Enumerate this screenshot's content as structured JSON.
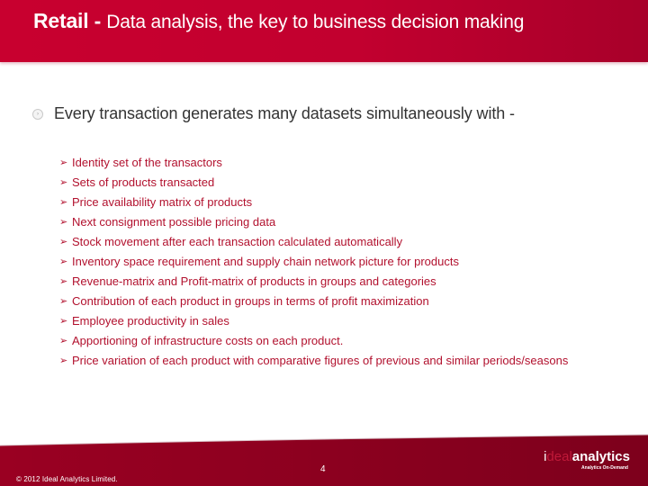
{
  "header": {
    "title_strong": "Retail - ",
    "title_rest": "Data analysis, the key to business decision making"
  },
  "main_point": "Every transaction generates many datasets simultaneously with  -",
  "sub_points": [
    "Identity set of the transactors",
    "Sets of products transacted",
    "Price availability matrix of products",
    "Next consignment possible pricing data",
    "Stock movement after each transaction calculated automatically",
    "Inventory space requirement and supply chain network picture for products",
    "Revenue-matrix and Profit-matrix of  products in groups and categories",
    "Contribution of each product in groups in terms of profit maximization",
    "Employee productivity in sales",
    "Apportioning of infrastructure costs on each product.",
    "Price variation of each product with comparative figures of previous and similar periods/seasons"
  ],
  "icons": {
    "main_bullet": "circle-chevron-icon",
    "sub_bullet": "arrowhead-icon",
    "sub_bullet_glyph": "➢"
  },
  "footer": {
    "copyright": "© 2012 Ideal Analytics Limited.",
    "page_number": "4",
    "logo_i": "i",
    "logo_deal": "deal",
    "logo_analytics": "analytics",
    "logo_tagline": "Analytics On-Demand"
  },
  "colors": {
    "brand_red": "#c8002f",
    "footer_red": "#8a0020",
    "bullet_text": "#b2112e",
    "body_text": "#333333"
  }
}
